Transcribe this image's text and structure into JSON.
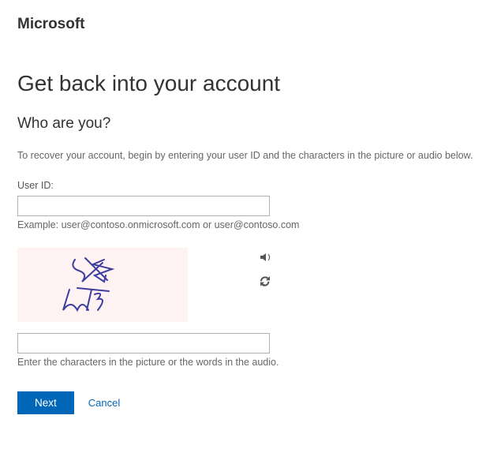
{
  "logo": "Microsoft",
  "heading": "Get back into your account",
  "subheading": "Who are you?",
  "instruction": "To recover your account, begin by entering your user ID and the characters in the picture or audio below.",
  "userId": {
    "label": "User ID:",
    "value": "",
    "example": "Example: user@contoso.onmicrosoft.com or user@contoso.com"
  },
  "captcha": {
    "value": "",
    "help": "Enter the characters in the picture or the words in the audio."
  },
  "buttons": {
    "next": "Next",
    "cancel": "Cancel"
  }
}
